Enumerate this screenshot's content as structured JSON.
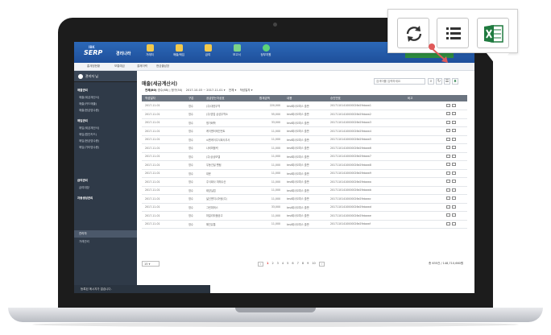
{
  "topbar": {
    "logo_small": "IBK",
    "logo": "SERP",
    "logo_suffix": "경리나라",
    "nav": [
      {
        "label": "거래처",
        "icon": "building-icon",
        "color": "#f2c94c"
      },
      {
        "label": "매출/매입",
        "icon": "invoice-icon",
        "color": "#f2c94c"
      },
      {
        "label": "급여",
        "icon": "payroll-icon",
        "color": "#f2c94c"
      },
      {
        "label": "보고서",
        "icon": "report-icon",
        "color": "#7bd389"
      },
      {
        "label": "정부지원",
        "icon": "dollar-coin-icon",
        "color": "#5cd37a"
      }
    ]
  },
  "subbar": {
    "items": [
      "홈계정현황",
      "보통예금",
      "결제이력",
      "현금출납장"
    ]
  },
  "sidebar": {
    "user": "관리자 님",
    "items": [
      {
        "label": "매출관리",
        "header": true
      },
      {
        "label": "매출(세금계산서)",
        "header": false
      },
      {
        "label": "매출(카드매출)",
        "header": false
      },
      {
        "label": "매출(현금영수증)",
        "header": false
      },
      {
        "label": "매입관리",
        "header": true
      },
      {
        "label": "매입(세금계산서)",
        "header": false
      },
      {
        "label": "매입(법인카드)",
        "header": false
      },
      {
        "label": "매입(현금영수증)",
        "header": false
      },
      {
        "label": "매입(기타영수증)",
        "header": false
      },
      {
        "label": "급여관리",
        "header": true
      },
      {
        "label": "급여대장",
        "header": false
      },
      {
        "label": "자동생성관리",
        "header": true
      },
      {
        "label": "관리자",
        "header": false
      },
      {
        "label": "거래관리",
        "header": false
      }
    ],
    "footer": "등록된 메시지가 없습니다."
  },
  "main": {
    "title": "매출(세금계산서)",
    "search_placeholder": "검색어를 입력하세요",
    "filter": {
      "total": "전체(80)",
      "detail": "영수(68) | 청구(50)",
      "range": "2017-10-03 ~ 2017-11-01",
      "status": "전체",
      "sort": "작성일자"
    },
    "columns": [
      "작성일자",
      "구분",
      "공급받는자상호",
      "합계금액",
      "내용",
      "승인번호",
      "비고"
    ],
    "rows": [
      [
        "2017-11-01",
        "영수",
        "(주)대한무역",
        "220,000",
        "test회사오피스 출판",
        "20171101410000026e29doxw1"
      ],
      [
        "2017-11-01",
        "영수",
        "(주)영업 삼성무역소",
        "55,000",
        "test회사오피스 출판",
        "20171101410000026e29doxw2"
      ],
      [
        "2017-11-01",
        "영수",
        "명가화학",
        "33,000",
        "test회사오피스 출판",
        "20171101410000026e29doxw3"
      ],
      [
        "2017-11-01",
        "영수",
        "케이엔터테인먼트",
        "11,000",
        "test회사오피스 출판",
        "20171101410000026e29doxw4"
      ],
      [
        "2017-11-01",
        "영수",
        "씨엔케이주식회사무사",
        "11,000",
        "test회사오피스 출판",
        "20171101410000026e29doxw5"
      ],
      [
        "2017-11-01",
        "영수",
        "나비퍼블릭",
        "11,000",
        "test회사오피스 출판",
        "20171101410000026e29doxw6"
      ],
      [
        "2017-11-01",
        "영수",
        "(주)상상모델",
        "11,000",
        "test회사오피스 출판",
        "20171101410000026e29doxw7"
      ],
      [
        "2017-11-01",
        "영수",
        "우동건설 팬텀",
        "11,000",
        "test회사오피스 출판",
        "20171101410000026e29doxw8"
      ],
      [
        "2017-11-01",
        "영수",
        "대운",
        "11,000",
        "test회사오피스 출판",
        "20171101410000026e29doxw9"
      ],
      [
        "2017-11-01",
        "영수",
        "주식회사 미래수산",
        "11,000",
        "test회사오피스 출판",
        "20171101410000026e29doxwa"
      ],
      [
        "2017-11-01",
        "영수",
        "태양실업",
        "11,000",
        "test회사오피스 출판",
        "20171101410000026e29doxwb"
      ],
      [
        "2017-11-01",
        "영수",
        "넓선엔지니어링(주)",
        "11,000",
        "test회사오피스 출판",
        "20171101410000026e29doxwc"
      ],
      [
        "2017-11-01",
        "영수",
        "그린파머스",
        "33,000",
        "test회사오피스 출판",
        "20171101410000026e29doxwd"
      ],
      [
        "2017-11-01",
        "영수",
        "마일리타몰공고",
        "11,000",
        "test회사오피스 출판",
        "20171101410000026e29doxwe"
      ],
      [
        "2017-11-01",
        "영수",
        "해진유통",
        "11,000",
        "test회사오피스 출판",
        "20171101410000026e29doxwf"
      ]
    ],
    "pager": {
      "page_size": "15",
      "pages": [
        "1",
        "2",
        "3",
        "4",
        "5",
        "6",
        "7",
        "8",
        "9",
        "10"
      ],
      "current": "1",
      "total": "총 635건 / 148,710,660원"
    }
  },
  "callout": {
    "buttons": [
      {
        "name": "refresh-button",
        "icon": "refresh-icon"
      },
      {
        "name": "list-button",
        "icon": "list-icon"
      },
      {
        "name": "excel-button",
        "icon": "excel-icon",
        "color": "#1f7a3f"
      }
    ]
  }
}
